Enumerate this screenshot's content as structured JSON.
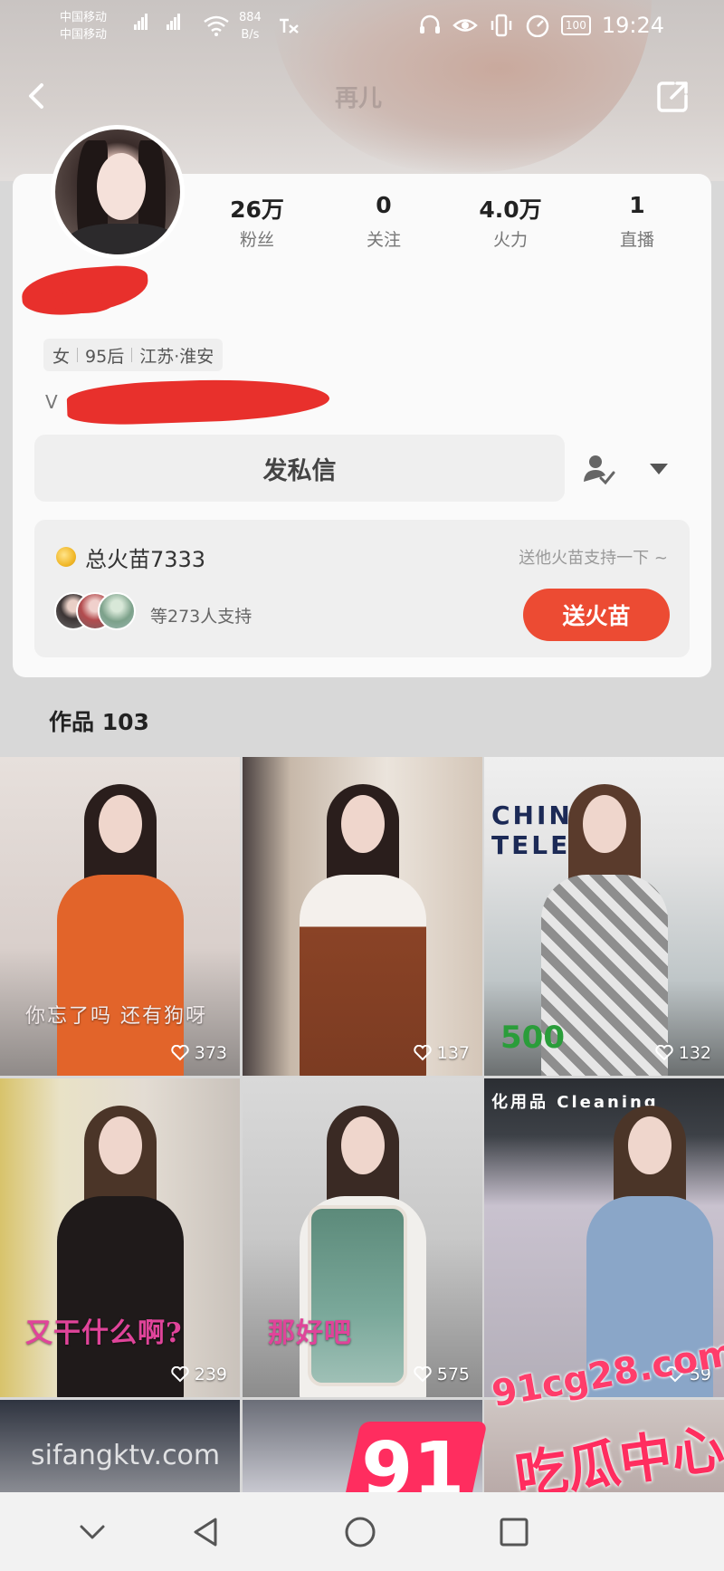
{
  "status_bar": {
    "carrier_1": "中国移动",
    "carrier_2": "中国移动",
    "speed_value": "884",
    "speed_unit": "B/s",
    "battery": "100",
    "time": "19:24"
  },
  "header": {
    "title": "再儿"
  },
  "profile": {
    "stats": [
      {
        "value": "26万",
        "label": "粉丝"
      },
      {
        "value": "0",
        "label": "关注"
      },
      {
        "value": "4.0万",
        "label": "火力"
      },
      {
        "value": "1",
        "label": "直播"
      }
    ],
    "tags": {
      "gender": "女",
      "age": "95后",
      "location": "江苏·淮安"
    },
    "bio_prefix": "V",
    "message_button": "发私信"
  },
  "fire": {
    "total_label": "总火苗7333",
    "hint": "送他火苗支持一下 ~",
    "supporters_text": "等273人支持",
    "send_button": "送火苗"
  },
  "works": {
    "title": "作品 103",
    "items": [
      {
        "likes": "373",
        "caption": "你忘了吗 还有狗呀"
      },
      {
        "likes": "137",
        "caption": ""
      },
      {
        "likes": "132",
        "caption": "500",
        "banner": "CHINA TELECOM"
      },
      {
        "likes": "239",
        "caption": "又干什么啊?"
      },
      {
        "likes": "575",
        "caption": "那好吧"
      },
      {
        "likes": "59",
        "caption": "",
        "banner": "化用品 Cleaning"
      }
    ]
  },
  "watermark": {
    "url": "91cg28.com",
    "number": "91",
    "text": "吃瓜中心",
    "faded": "sifangktv.com"
  },
  "icons": {
    "back": "chevron-left-icon",
    "share": "share-icon",
    "follow": "user-check-icon",
    "dropdown": "triangle-down-icon",
    "heart": "heart-outline-icon"
  },
  "colors": {
    "accent": "#ec4b33",
    "watermark": "#ff2d5f"
  }
}
